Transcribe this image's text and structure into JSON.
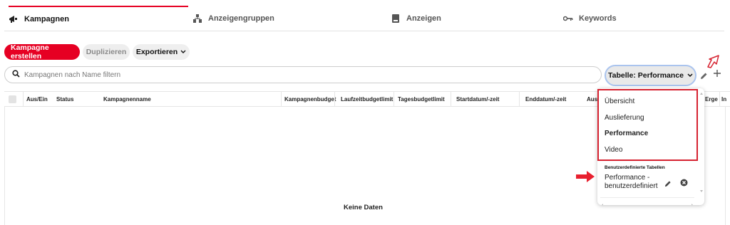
{
  "tabs": [
    {
      "label": "Kampagnen",
      "icon": "megaphone-icon",
      "active": true
    },
    {
      "label": "Anzeigengruppen",
      "icon": "org-chart-icon",
      "active": false
    },
    {
      "label": "Anzeigen",
      "icon": "ad-card-icon",
      "active": false
    },
    {
      "label": "Keywords",
      "icon": "key-icon",
      "active": false
    }
  ],
  "toolbar": {
    "create_label": "Kampagne erstellen",
    "duplicate_label": "Duplizieren",
    "export_label": "Exportieren"
  },
  "search": {
    "placeholder": "Kampagnen nach Name filtern"
  },
  "table_select": {
    "label": "Tabelle: Performance"
  },
  "table": {
    "columns": [
      "Aus/Ein",
      "Status",
      "Kampagnenname",
      "Kampagnenbudget",
      "Laufzeitbudgetlimit",
      "Tagesbudgetlimit",
      "Startdatum/-zeit",
      "Enddatum/-zeit",
      "Ausg",
      "Erge",
      "In"
    ],
    "empty_text": "Keine Daten"
  },
  "dropdown": {
    "items": [
      {
        "label": "Übersicht",
        "selected": false
      },
      {
        "label": "Auslieferung",
        "selected": false
      },
      {
        "label": "Performance",
        "selected": true
      },
      {
        "label": "Video",
        "selected": false
      }
    ],
    "custom_section_title": "Benutzerdefinierte Tabellen",
    "custom_item": "Performance - benutzerdefiniert"
  },
  "colors": {
    "accent": "#e60023",
    "highlight": "#d62230",
    "focus_ring": "#aac4ee"
  }
}
